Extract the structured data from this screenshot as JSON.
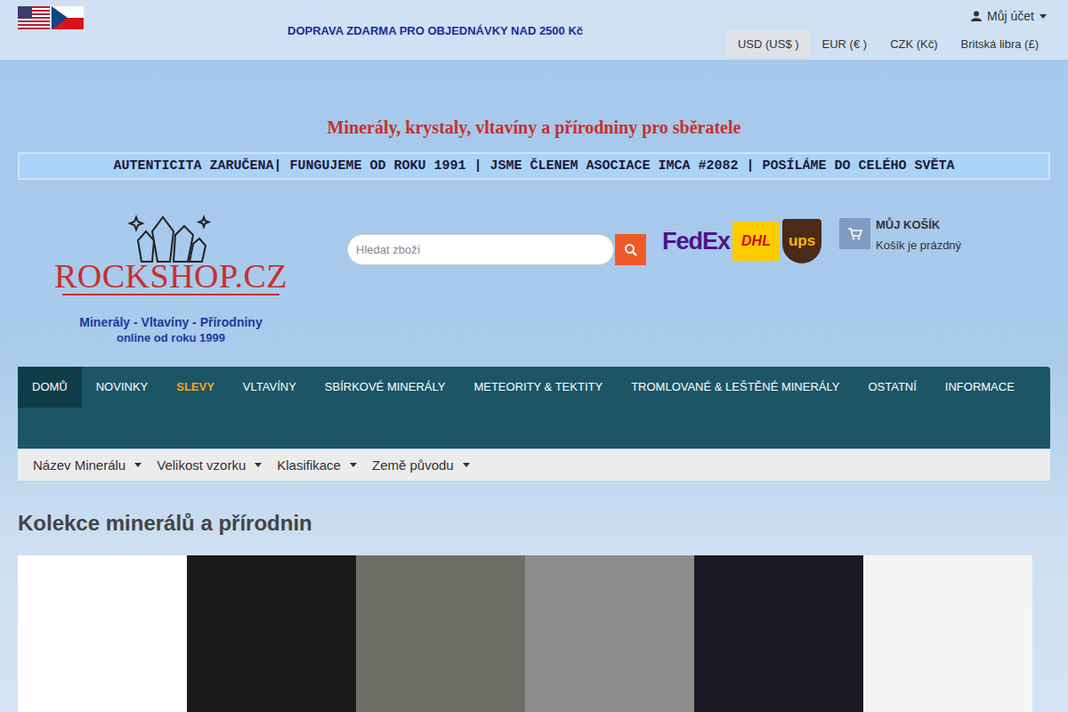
{
  "top_bar": {
    "flags": [
      {
        "kind": "us"
      },
      {
        "kind": "cz"
      }
    ],
    "shipping": "DOPRAVA ZDARMA PRO OBJEDNÁVKY NAD 2500 Kč",
    "account": "Můj účet",
    "currencies": [
      {
        "label": "USD (US$ )",
        "selected": true
      },
      {
        "label": "EUR (€ )",
        "selected": false
      },
      {
        "label": "CZK (Kč)",
        "selected": false
      },
      {
        "label": "Britská libra (£)",
        "selected": false
      }
    ]
  },
  "title": "Minerály, krystaly, vltavíny a přírodniny pro sběratele",
  "banner": "AUTENTICITA ZARUČENA| FUNGUJEME OD ROKU 1991 | JSME ČLENEM ASOCIACE IMCA #2082 | POSÍLÁME DO CELÉHO SVĚTA",
  "logo": {
    "name": "ROCKSHOP.CZ",
    "tagline": "Minerály - Vltavíny - Přírodniny",
    "since": "online od roku 1999"
  },
  "search": {
    "placeholder": "Hledat zboží"
  },
  "carriers": [
    {
      "text": "FedEx",
      "kind": "fedex"
    },
    {
      "text": "DHL",
      "kind": "dhl"
    },
    {
      "text": "ups",
      "kind": "ups"
    }
  ],
  "cart": {
    "title": "MŮJ KOŠÍK",
    "status": "Košík je prázdný"
  },
  "nav": [
    {
      "label": "DOMŮ",
      "selected": true,
      "color": "#ffffff"
    },
    {
      "label": "NOVINKY",
      "selected": false,
      "color": "#ffffff"
    },
    {
      "label": "SLEVY",
      "selected": false,
      "color": "#f5a623"
    },
    {
      "label": "VLTAVÍNY",
      "selected": false,
      "color": "#ffffff"
    },
    {
      "label": "SBÍRKOVÉ MINERÁLY",
      "selected": false,
      "color": "#ffffff"
    },
    {
      "label": "METEORITY & TEKTITY",
      "selected": false,
      "color": "#ffffff"
    },
    {
      "label": "TROMLOVANÉ & LEŠTĚNÉ MINERÁLY",
      "selected": false,
      "color": "#ffffff"
    },
    {
      "label": "OSTATNÍ",
      "selected": false,
      "color": "#ffffff"
    },
    {
      "label": "INFORMACE",
      "selected": false,
      "color": "#ffffff"
    }
  ],
  "filters": [
    "Název Minerálu",
    "Velikost vzorku",
    "Klasifikace",
    "Země původu"
  ],
  "heading": "Kolekce minerálů a přírodnin",
  "tiles": [
    {
      "color": "#ffffff"
    },
    {
      "color": "#1a1a1a"
    },
    {
      "color": "#6c6f66"
    },
    {
      "color": "#8d8d8d"
    },
    {
      "color": "#1c1a22"
    },
    {
      "color": "#f4f4f4"
    }
  ]
}
